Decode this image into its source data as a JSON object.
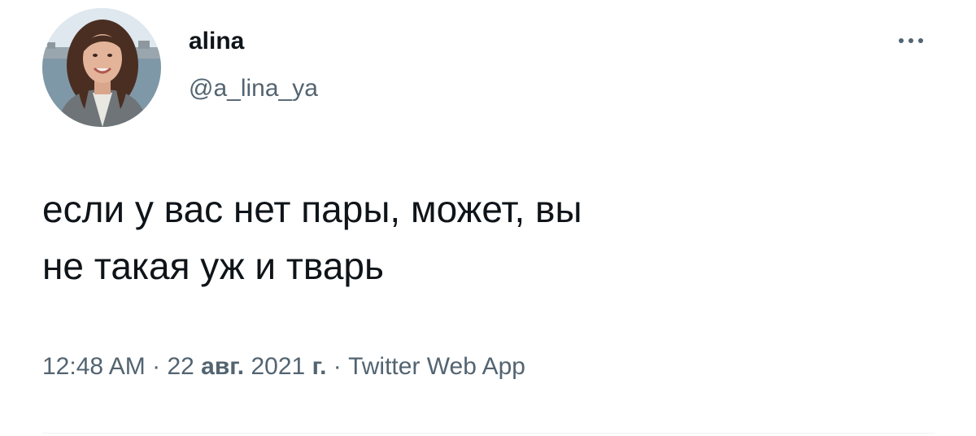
{
  "author": {
    "name": "alina",
    "handle": "@a_lina_ya"
  },
  "tweet": {
    "text_line_1": "если у вас нет пары, может, вы",
    "text_line_2": "не такая уж и тварь"
  },
  "meta": {
    "time": "12:48 AM",
    "separator": "·",
    "day": "22",
    "month": "авг.",
    "year": "2021",
    "year_suffix": "г.",
    "source": "Twitter Web App"
  },
  "icons": {
    "more": "more-horizontal-icon"
  },
  "colors": {
    "text": "#0f1419",
    "secondary": "#536471",
    "divider": "#eff3f4"
  }
}
